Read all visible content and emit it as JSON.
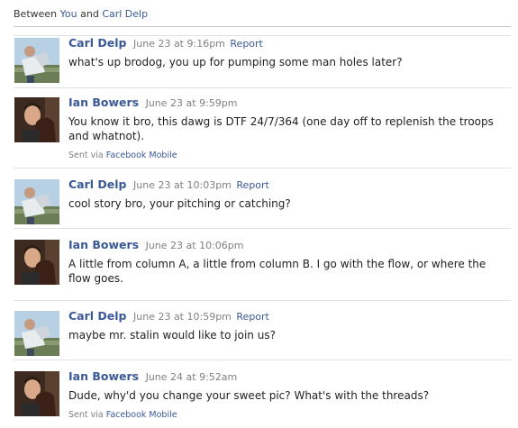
{
  "thread": {
    "between_prefix": "Between ",
    "participant_you": "You",
    "and_word": " and ",
    "participant_other": "Carl Delp"
  },
  "messages": [
    {
      "author": "Carl Delp",
      "time": "June 23 at 9:16pm",
      "report": "Report",
      "text": "what's up brodog, you up for pumping some man holes later?",
      "avatar": "carl-avatar"
    },
    {
      "author": "Ian Bowers",
      "time": "June 23 at 9:59pm",
      "text": "You know it bro, this dawg is DTF 24/7/364 (one day off to replenish the troops and whatnot).",
      "sent_via_prefix": "Sent via ",
      "sent_via_link": "Facebook Mobile",
      "avatar": "ian-avatar"
    },
    {
      "author": "Carl Delp",
      "time": "June 23 at 10:03pm",
      "report": "Report",
      "text": "cool story bro, your pitching or catching?",
      "avatar": "carl-avatar"
    },
    {
      "author": "Ian Bowers",
      "time": "June 23 at 10:06pm",
      "text": "A little from column A, a little from column B. I go with the flow, or where the flow goes.",
      "avatar": "ian-avatar"
    },
    {
      "author": "Carl Delp",
      "time": "June 23 at 10:59pm",
      "report": "Report",
      "text": "maybe mr. stalin would like to join us?",
      "avatar": "carl-avatar"
    },
    {
      "author": "Ian Bowers",
      "time": "June 24 at 9:52am",
      "text": "Dude, why'd you change your sweet pic? What's with the threads?",
      "sent_via_prefix": "Sent via ",
      "sent_via_link": "Facebook Mobile",
      "avatar": "ian-avatar"
    }
  ],
  "colors": {
    "link": "#3b5998",
    "meta": "#808080",
    "divider": "#e2e2e2"
  }
}
